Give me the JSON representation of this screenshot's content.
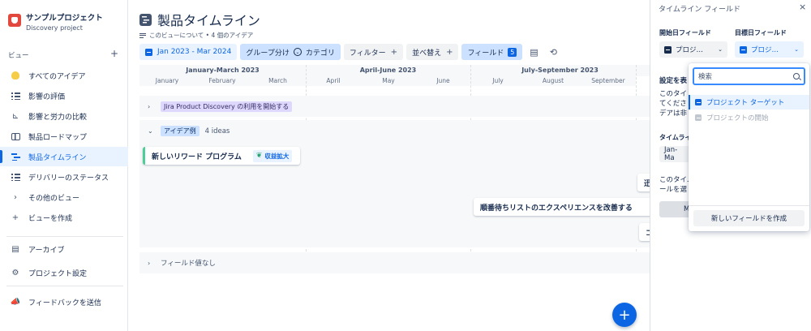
{
  "project": {
    "name": "サンプルプロジェクト",
    "subtitle": "Discovery project"
  },
  "sidebar": {
    "views_label": "ビュー",
    "add_symbol": "+",
    "items": [
      {
        "label": "すべてのアイデア",
        "icon": "lightbulb-icon"
      },
      {
        "label": "影響の評価",
        "icon": "list-icon"
      },
      {
        "label": "影響と労力の比較",
        "icon": "matrix-icon"
      },
      {
        "label": "製品ロードマップ",
        "icon": "board-icon"
      },
      {
        "label": "製品タイムライン",
        "icon": "timeline-icon",
        "active": true
      },
      {
        "label": "デリバリーのステータス",
        "icon": "list-icon"
      },
      {
        "label": "その他のビュー",
        "icon": "chevron-right-icon"
      },
      {
        "label": "ビューを作成",
        "icon": "plus-icon"
      }
    ],
    "archive": "アーカイブ",
    "settings": "プロジェクト設定",
    "feedback": "フィードバックを送信"
  },
  "main": {
    "title": "製品タイムライン",
    "about": "このビューについて • 4 個のアイデア",
    "toolbar": {
      "date_range": "Jan 2023 - Mar 2024",
      "group_by": "グループ分け",
      "group_value": "カテゴリ",
      "filter": "フィルター",
      "sort": "並べ替え",
      "fields": "フィールド",
      "fields_count": "5",
      "plus": "+"
    },
    "quarters": [
      "January-March 2023",
      "April-June 2023",
      "July-September 2023"
    ],
    "months": [
      "January",
      "February",
      "March",
      "April",
      "May",
      "June",
      "July",
      "August",
      "September"
    ],
    "groups": [
      {
        "label": "Jira Product Discovery の利用を開始する",
        "chevron": "›"
      },
      {
        "label": "アイデア例",
        "count": "4 ideas",
        "chevron": "⌄"
      },
      {
        "label": "フィールド値なし",
        "chevron": "›"
      }
    ],
    "cards": [
      {
        "title": "新しいリワード プログラム",
        "tag": "収益拡大"
      },
      {
        "title": "順番待ちリストのエクスペリエンスを改善する"
      },
      {
        "title": "迅"
      },
      {
        "title": "コ"
      }
    ]
  },
  "panel": {
    "title": "タイムライン フィールド",
    "close": "×",
    "start_label": "開始日フィールド",
    "start_value": "プロジ…",
    "target_label": "目標日フィールド",
    "target_value": "プロジ…",
    "config_heading": "設定を表",
    "desc_lines": [
      "このタイ",
      "てくださ",
      "デアは非"
    ],
    "timeline_label": "タイムライ",
    "timeline_value": "Jan-Ma",
    "desc2_lines": [
      "このタイム",
      "ールを選"
    ],
    "button_stub": "M"
  },
  "dropdown": {
    "search_placeholder": "検索",
    "options": [
      {
        "label": "プロジェクト ターゲット",
        "selected": true
      },
      {
        "label": "プロジェクトの開始",
        "disabled": true
      }
    ],
    "create_new": "新しいフィールドを作成"
  },
  "colors": {
    "accent": "#0c66e4",
    "active_bg": "#e9f2ff",
    "lozenge_purple": "#dfd8fd",
    "card_green": "#4bce97",
    "logo_red": "#e2483d"
  }
}
